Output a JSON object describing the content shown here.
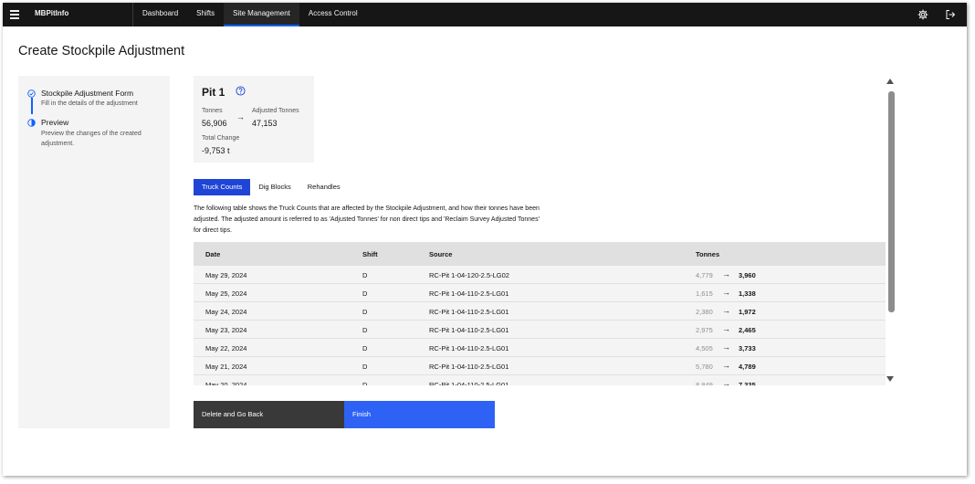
{
  "header": {
    "app_name": "MBPitInfo",
    "nav": [
      {
        "label": "Dashboard",
        "active": false
      },
      {
        "label": "Shifts",
        "active": false
      },
      {
        "label": "Site Management",
        "active": true
      },
      {
        "label": "Access Control",
        "active": false
      }
    ],
    "icons": {
      "menu": "hamburger-icon",
      "settings": "gear-icon",
      "logout": "logout-icon"
    }
  },
  "page": {
    "title": "Create Stockpile Adjustment"
  },
  "progress": {
    "steps": [
      {
        "title": "Stockpile Adjustment Form",
        "subtitle": "Fill in the details of the adjustment",
        "state": "complete"
      },
      {
        "title": "Preview",
        "subtitle": "Preview the changes of the created adjustment.",
        "state": "current"
      }
    ]
  },
  "pit": {
    "name": "Pit 1",
    "tonnes_label": "Tonnes",
    "tonnes": "56,906",
    "adjusted_label": "Adjusted Tonnes",
    "adjusted": "47,153",
    "change_label": "Total Change",
    "change": "-9,753 t"
  },
  "tabs": [
    {
      "label": "Truck Counts",
      "active": true
    },
    {
      "label": "Dig Blocks",
      "active": false
    },
    {
      "label": "Rehandles",
      "active": false
    }
  ],
  "description": "The following table shows the Truck Counts that are affected by the Stockpile Adjustment, and how their tonnes have been adjusted. The adjusted amount is referred to as 'Adjusted Tonnes' for non direct tips and 'Reclaim Survey Adjusted Tonnes' for direct tips.",
  "table": {
    "headers": {
      "date": "Date",
      "shift": "Shift",
      "source": "Source",
      "tonnes": "Tonnes"
    },
    "arrow": "→",
    "rows": [
      {
        "date": "May 29, 2024",
        "shift": "D",
        "source": "RC-Pit 1-04-120-2.5-LG02",
        "old": "4,779",
        "new": "3,960"
      },
      {
        "date": "May 25, 2024",
        "shift": "D",
        "source": "RC-Pit 1-04-110-2.5-LG01",
        "old": "1,615",
        "new": "1,338"
      },
      {
        "date": "May 24, 2024",
        "shift": "D",
        "source": "RC-Pit 1-04-110-2.5-LG01",
        "old": "2,380",
        "new": "1,972"
      },
      {
        "date": "May 23, 2024",
        "shift": "D",
        "source": "RC-Pit 1-04-110-2.5-LG01",
        "old": "2,975",
        "new": "2,465"
      },
      {
        "date": "May 22, 2024",
        "shift": "D",
        "source": "RC-Pit 1-04-110-2.5-LG01",
        "old": "4,505",
        "new": "3,733"
      },
      {
        "date": "May 21, 2024",
        "shift": "D",
        "source": "RC-Pit 1-04-110-2.5-LG01",
        "old": "5,780",
        "new": "4,789"
      },
      {
        "date": "May 20, 2024",
        "shift": "D",
        "source": "RC-Pit 1-04-110-2.5-LG01",
        "old": "8,849",
        "new": "7,335"
      }
    ]
  },
  "buttons": {
    "back": "Delete and Go Back",
    "finish": "Finish"
  },
  "colors": {
    "primary": "#0f62fe",
    "tab_active": "#1f45d6",
    "finish": "#2d62f5",
    "topbar": "#161616"
  }
}
